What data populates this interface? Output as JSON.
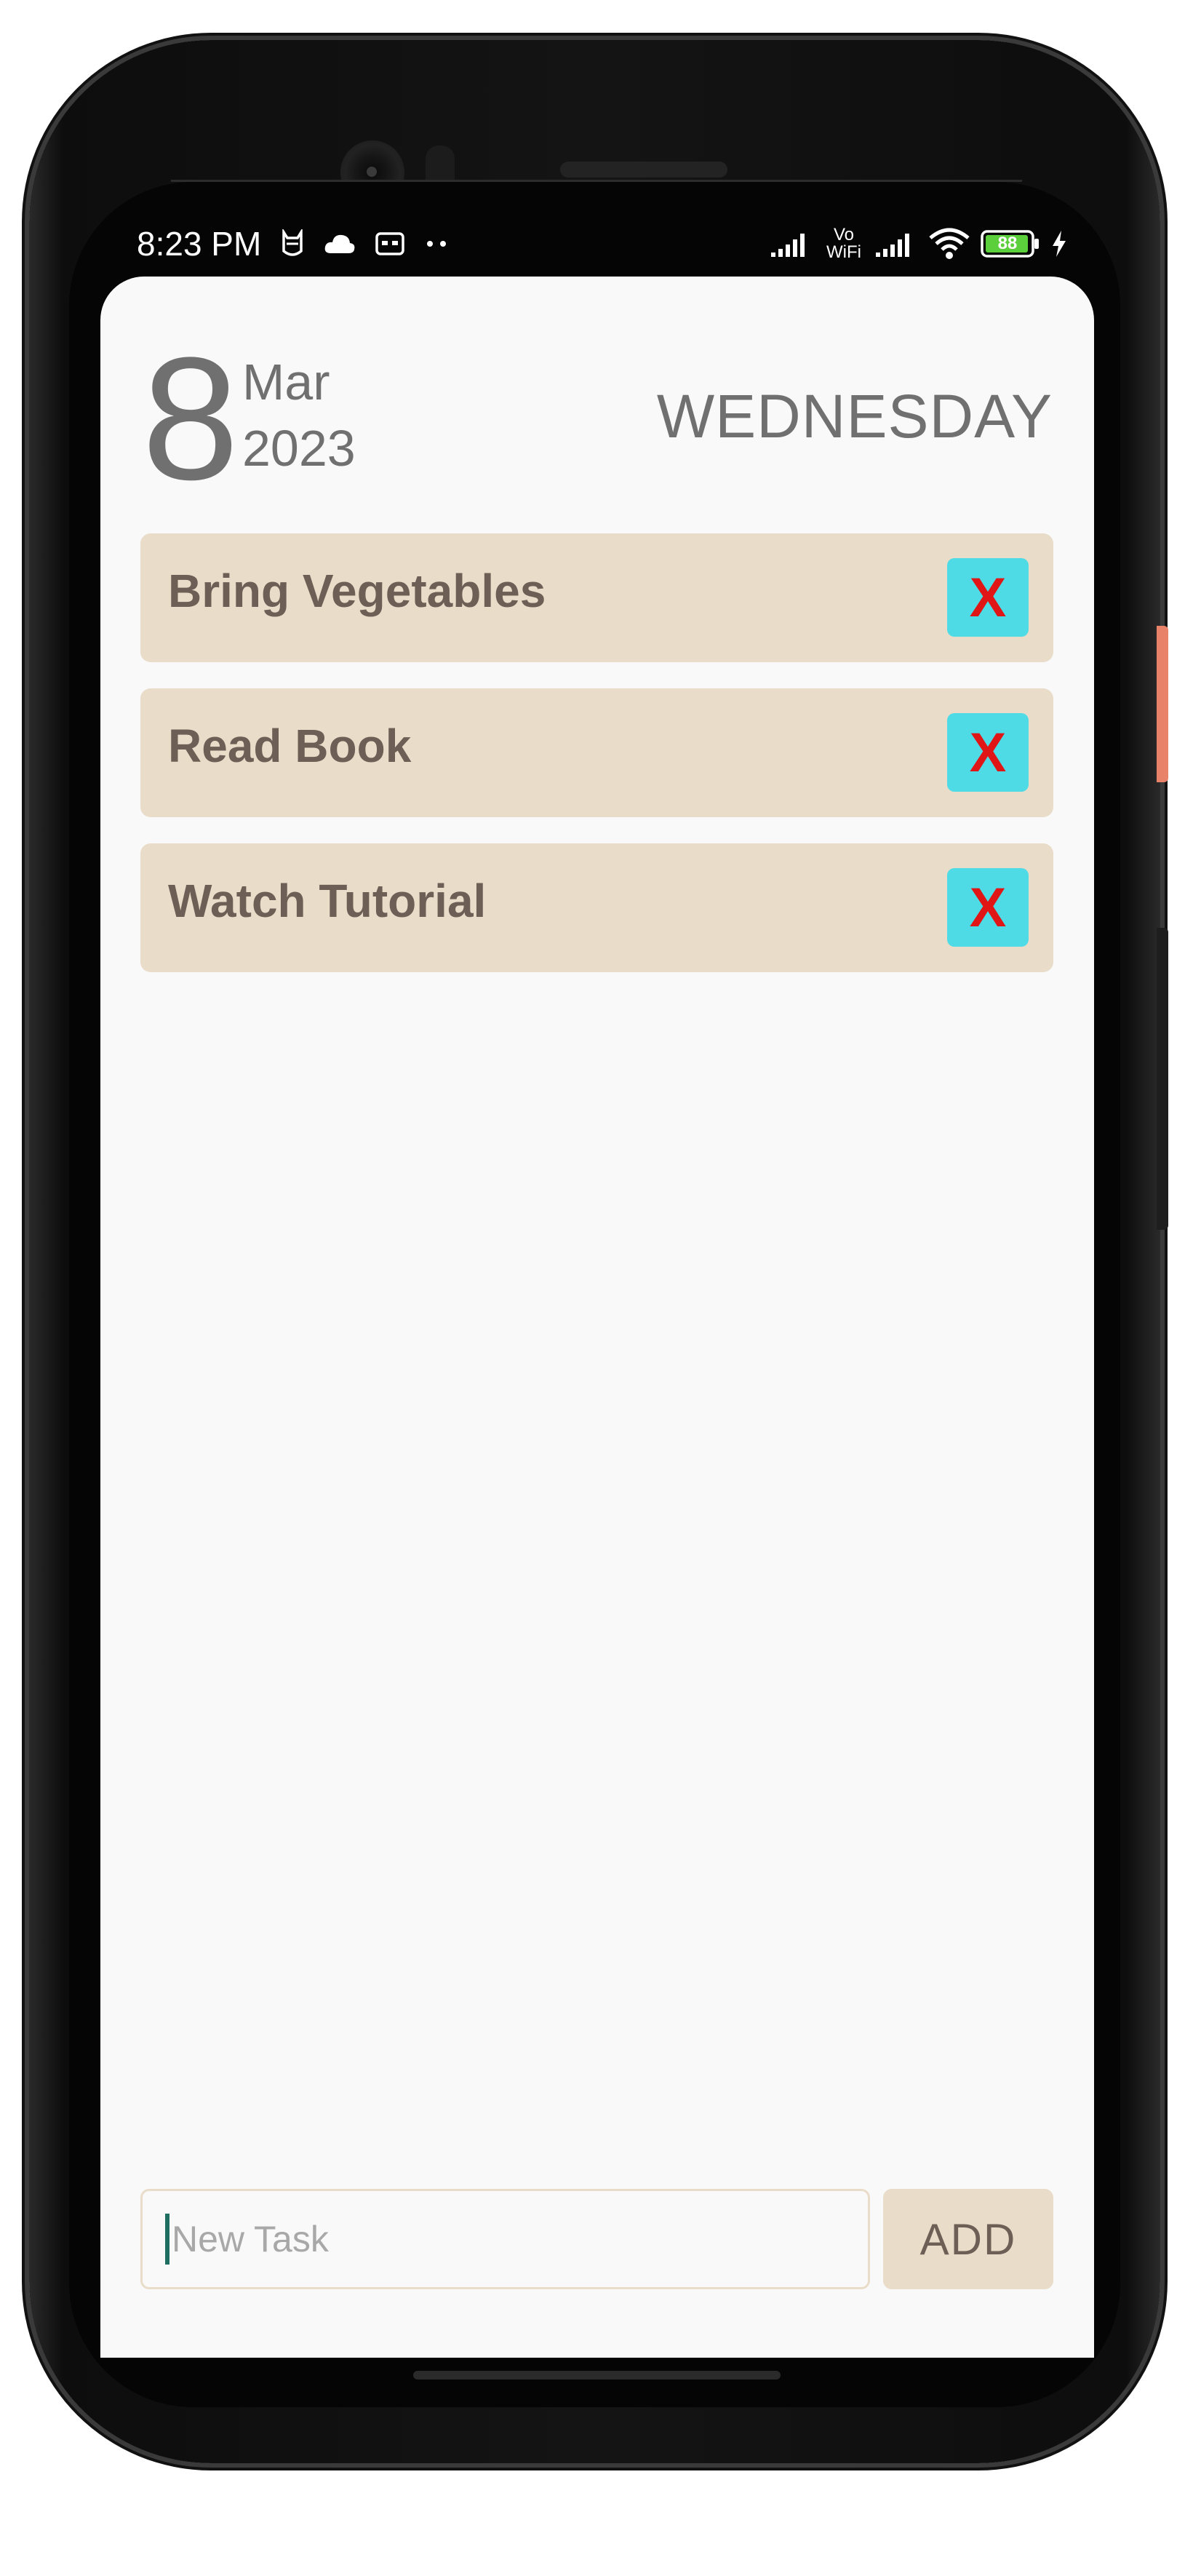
{
  "status_bar": {
    "time": "8:23 PM",
    "battery_level": "88",
    "network_label_top": "Vo",
    "network_label_bottom": "WiFi",
    "icons": [
      "cat-face-icon",
      "cloud-icon",
      "vr-box-icon",
      "more-dots-icon",
      "signal-bars-icon",
      "vowifi-icon",
      "signal-bars-icon",
      "wifi-icon",
      "battery-icon",
      "charging-bolt-icon"
    ]
  },
  "date_header": {
    "day": "8",
    "month": "Mar",
    "year": "2023",
    "weekday": "WEDNESDAY"
  },
  "tasks": [
    {
      "label": "Bring Vegetables",
      "delete_label": "X"
    },
    {
      "label": "Read Book",
      "delete_label": "X"
    },
    {
      "label": "Watch Tutorial",
      "delete_label": "X"
    }
  ],
  "new_task": {
    "value": "",
    "placeholder": "New Task",
    "add_label": "ADD"
  },
  "colors": {
    "accent_beige": "#e9dcc9",
    "delete_button_bg": "#4fdbe6",
    "delete_x": "#e01616",
    "text_gray": "#707070",
    "task_text": "#6d5f55",
    "screen_bg": "#f9f9f9"
  }
}
